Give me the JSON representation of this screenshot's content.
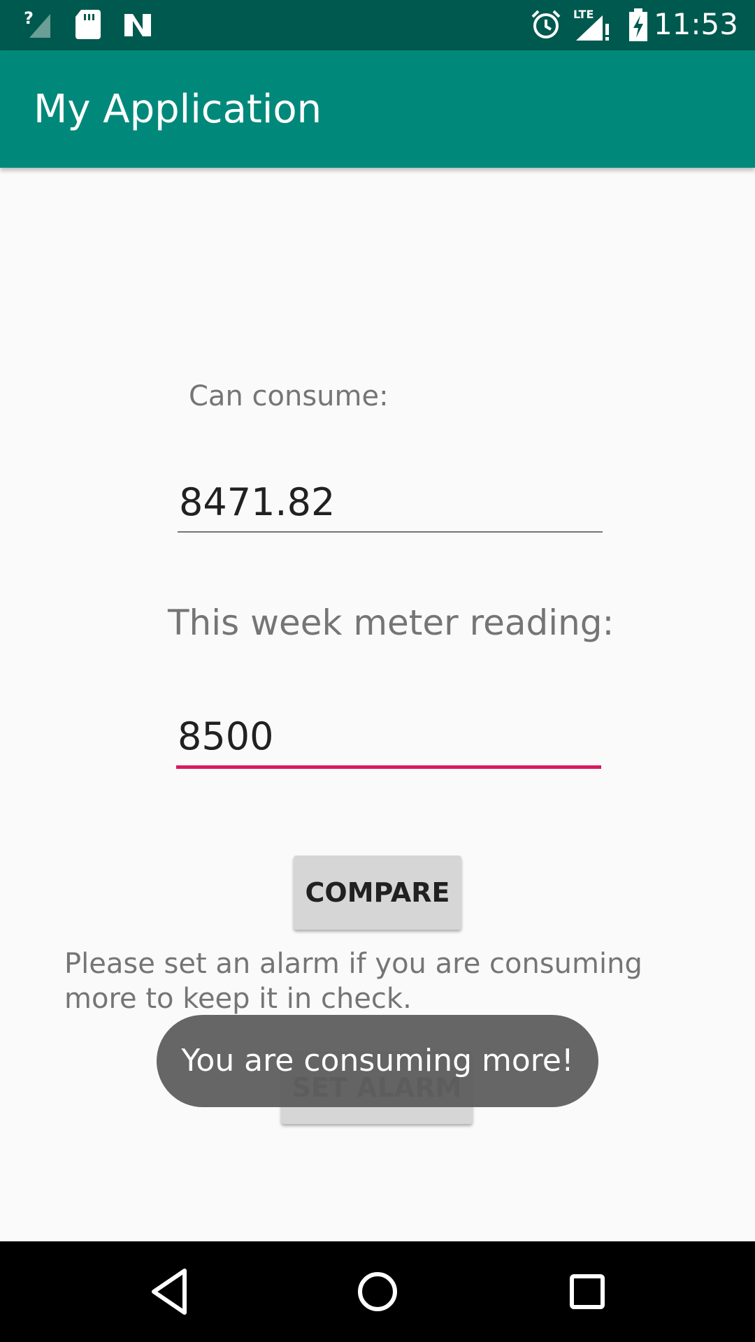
{
  "status_bar": {
    "time": "11:53",
    "icons": [
      "signal-unknown-icon",
      "sd-card-icon",
      "n-notification-icon",
      "alarm-icon",
      "lte-signal-icon",
      "battery-charging-icon"
    ]
  },
  "app_bar": {
    "title": "My Application"
  },
  "form": {
    "can_consume_label": "Can consume:",
    "can_consume_value": "8471.82",
    "reading_label": "This week meter reading:",
    "reading_value": "8500",
    "compare_label": "COMPARE",
    "hint_text": "Please set an alarm if you are consuming more to keep it in check.",
    "set_alarm_label": "SET ALARM"
  },
  "toast": {
    "message": "You are consuming more!"
  },
  "nav_bar": {
    "icons": [
      "back-icon",
      "home-icon",
      "recents-icon"
    ]
  },
  "colors": {
    "status_bar": "#00594e",
    "app_bar": "#00897b",
    "accent": "#d81b60"
  }
}
